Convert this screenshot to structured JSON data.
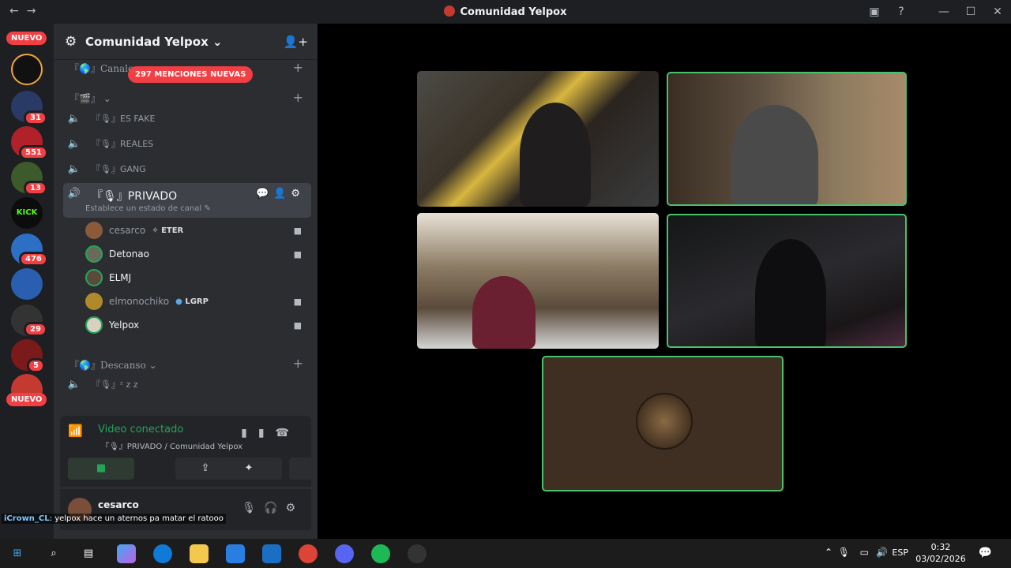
{
  "window": {
    "title": "Comunidad Yelpox"
  },
  "rail": {
    "new_top": "NUEVO",
    "new_bottom": "NUEVO",
    "badges": [
      "31",
      "551",
      "13",
      "476",
      "29",
      "5"
    ]
  },
  "guild": {
    "name": "Comunidad Yelpox",
    "mentions": "297 MENCIONES NUEVAS"
  },
  "categories": {
    "canales": "『🌎』Canales",
    "cat2": "『🎬』",
    "descanso": "『🌎』Descanso"
  },
  "channels": [
    {
      "label": "『🎙』ES FAKE"
    },
    {
      "label": "『🎙』REALES"
    },
    {
      "label": "『🎙』GANG"
    },
    {
      "label": "『🎙』PRIVADO",
      "status": "Establece un estado de canal"
    },
    {
      "label": "『🎙』ᶻ z 𝗓"
    }
  ],
  "members": [
    {
      "name": "cesarco",
      "tag": "✧ ETER",
      "color": "#949ba4"
    },
    {
      "name": "Detonao",
      "tag": "",
      "color": "#f2f3f5"
    },
    {
      "name": "ELMJ",
      "tag": "",
      "color": "#f2f3f5"
    },
    {
      "name": "elmonochiko",
      "tag": "LGRP",
      "color": "#949ba4"
    },
    {
      "name": "Yelpox",
      "tag": "",
      "color": "#f2f3f5"
    }
  ],
  "voice": {
    "title": "Video conectado",
    "subtitle": "『🎙』PRIVADO / Comunidad Yelpox"
  },
  "user": {
    "name": "cesarco"
  },
  "overlay": {
    "nick": "iCrown_CL",
    "message": ": yelpox hace un aternos pa matar el ratooo"
  },
  "taskbar": {
    "lang": "ESP",
    "time": "0:32",
    "date": "03/02/2026"
  },
  "colors": {
    "accent_green": "#23a559",
    "danger": "#f23f43",
    "speaking": "#4ac06b"
  }
}
